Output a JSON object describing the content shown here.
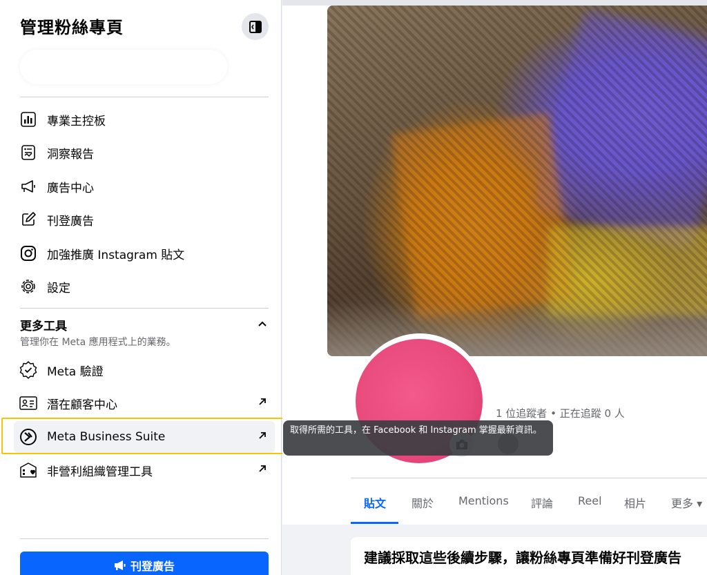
{
  "sidebar": {
    "title": "管理粉絲專頁",
    "items": [
      {
        "label": "專業主控板",
        "icon": "dashboard-icon"
      },
      {
        "label": "洞察報告",
        "icon": "insights-icon"
      },
      {
        "label": "廣告中心",
        "icon": "megaphone-icon"
      },
      {
        "label": "刊登廣告",
        "icon": "edit-icon"
      },
      {
        "label": "加強推廣 Instagram 貼文",
        "icon": "instagram-icon"
      },
      {
        "label": "設定",
        "icon": "gear-icon"
      }
    ],
    "more_tools": {
      "title": "更多工具",
      "subtitle": "管理你在 Meta 應用程式上的業務。",
      "items": [
        {
          "label": "Meta 驗證",
          "icon": "verified-icon",
          "external": false
        },
        {
          "label": "潛在顧客中心",
          "icon": "leads-icon",
          "external": true
        },
        {
          "label": "Meta Business Suite",
          "icon": "business-suite-icon",
          "external": true
        },
        {
          "label": "非營利組織管理工具",
          "icon": "nonprofit-icon",
          "external": true
        }
      ]
    },
    "ad_button": "刊登廣告"
  },
  "profile": {
    "followers": "1 位追蹤者 • 正在追蹤 0 人"
  },
  "tooltip": {
    "text": "取得所需的工具，在 Facebook 和 Instagram 掌握最新資訊。"
  },
  "tabs": [
    "貼文",
    "關於",
    "Mentions",
    "評論",
    "Reel",
    "相片",
    "更多 ▾"
  ],
  "card": {
    "title": "建議採取這些後續步驟，讓粉絲專頁準備好刊登廣告"
  },
  "colors": {
    "accent": "#0866ff",
    "highlight": "#f7c600"
  }
}
